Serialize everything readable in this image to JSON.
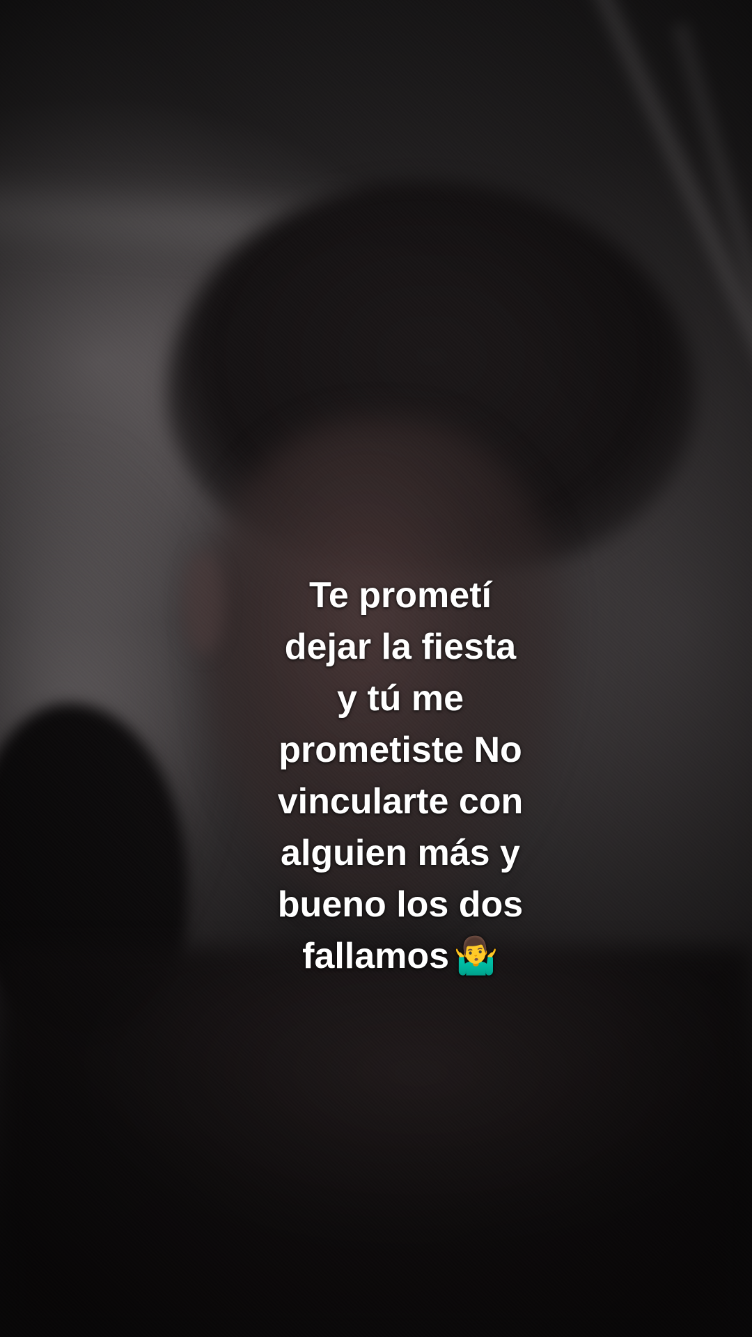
{
  "caption": {
    "lines": [
      "Te prometí",
      "dejar la fiesta",
      "y tú me",
      "prometiste No",
      "vincularte con",
      "alguien más y",
      "bueno los dos",
      "fallamos"
    ],
    "emoji": "🤷‍♂️",
    "emoji_name": "man-shrugging-icon",
    "text_color": "#ffffff"
  }
}
